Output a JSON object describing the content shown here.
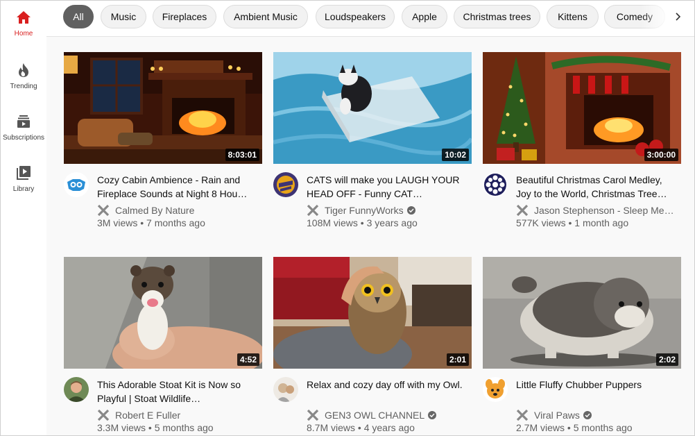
{
  "sidebar": {
    "items": [
      {
        "label": "Home",
        "icon": "home-icon",
        "active": true
      },
      {
        "label": "Trending",
        "icon": "flame-icon",
        "active": false
      },
      {
        "label": "Subscriptions",
        "icon": "subscriptions-icon",
        "active": false
      },
      {
        "label": "Library",
        "icon": "library-icon",
        "active": false
      }
    ]
  },
  "chips": [
    "All",
    "Music",
    "Fireplaces",
    "Ambient Music",
    "Loudspeakers",
    "Apple",
    "Christmas trees",
    "Kittens",
    "Comedy"
  ],
  "active_chip": "All",
  "colors": {
    "accent": "#d91f1f",
    "chip_active": "#606060",
    "meta_text": "#606060"
  },
  "videos": [
    {
      "title": "Cozy Cabin Ambience - Rain and Fireplace Sounds at Night 8 Hou…",
      "channel": "Calmed By Nature",
      "verified": false,
      "views": "3M views",
      "age": "7 months ago",
      "duration": "8:03:01"
    },
    {
      "title": "CATS will make you LAUGH YOUR HEAD OFF - Funny CAT…",
      "channel": "Tiger FunnyWorks",
      "verified": true,
      "views": "108M views",
      "age": "3 years ago",
      "duration": "10:02"
    },
    {
      "title": "Beautiful Christmas Carol Medley, Joy to the World, Christmas Tree…",
      "channel": "Jason Stephenson - Sleep Me…",
      "verified": false,
      "views": "577K views",
      "age": "1 month ago",
      "duration": "3:00:00"
    },
    {
      "title": "This Adorable Stoat Kit is Now so Playful | Stoat Wildlife…",
      "channel": "Robert E Fuller",
      "verified": false,
      "views": "3.3M views",
      "age": "5 months ago",
      "duration": "4:52"
    },
    {
      "title": "Relax and cozy day off with my Owl.",
      "channel": "GEN3 OWL CHANNEL",
      "verified": true,
      "views": "8.7M views",
      "age": "4 years ago",
      "duration": "2:01"
    },
    {
      "title": "Little Fluffy Chubber Puppers",
      "channel": "Viral Paws",
      "verified": true,
      "views": "2.7M views",
      "age": "5 months ago",
      "duration": "2:02"
    }
  ]
}
